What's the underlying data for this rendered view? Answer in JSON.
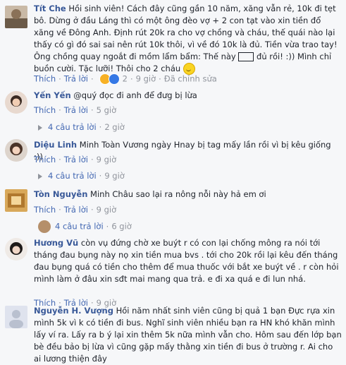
{
  "comments": [
    {
      "author": "Tít Che",
      "text_a": "Hồi sinh viên! Cách đây cũng gần 10 năm, xăng vẫn rẻ, 10k đi tẹt bô. Dừng ở đầu Láng thì có một ông đèo vợ + 2 con tạt vào xin tiền đổ xăng về Đông Anh. Định rút 20k ra cho vợ chồng và cháu, thế quái nào lại thấy có gì đó sai sai nên rút 10k thôi, vì về đó 10k là đủ. Tiền vừa trao tay! Ông chồng quay ngoắt đi mồm lẩm bẩm: Thế này",
      "text_b": "đủ rồi! :)) Mình chỉ buồn cười. Tặc lưỡi! Thôi cho 2 cháu",
      "like": "Thích",
      "reply": "Trả lời",
      "reaction_count": "2",
      "time": "9 giờ",
      "edited": "Đã chỉnh sửa"
    },
    {
      "author": "Yến Yến",
      "text": "@quý đọc đi anh để đưg bị lừa",
      "like": "Thích",
      "reply": "Trả lời",
      "time": "5 giờ",
      "replies": "4 câu trả lời",
      "replies_time": "2 giờ"
    },
    {
      "author": "Diệu Linh",
      "text": "Minh Toàn Vương ngày Hnay bị tag mấy lần rồi vì bị kêu giống :))",
      "like": "Thích",
      "reply": "Trả lời",
      "time": "9 giờ",
      "replies": "4 câu trả lời",
      "replies_time": "9 giờ"
    },
    {
      "author": "Tòn Nguyễn",
      "text": "Minh Châu sao lại ra nông nỗi này hả em ơi",
      "like": "Thích",
      "reply": "Trả lời",
      "time": "9 giờ",
      "replies": "4 câu trả lời",
      "replies_time": "6 giờ"
    },
    {
      "author": "Hương Vũ",
      "text": "còn vụ đứng chờ xe buýt r có con lại chống mông ra nói tới tháng đau bụng này nọ xin tiền mua bvs . tới cho 20k rồi lại kêu đến tháng đau bụng quá có tiền cho thêm để mua thuốc với bắt xe buýt về . r còn hỏi mình làm ở đâu xin sđt mai mang qua trả. e đi xa quá e đi lun nhá.",
      "like": "Thích",
      "reply": "Trả lời",
      "time": "9 giờ"
    },
    {
      "author": "Nguyễn H. Vượng",
      "text": "Hồi năm nhất sinh viên cũng bị quả 1 bạn Đực rựa xin mình 5k vì k có tiền đi bus. Nghĩ sinh viên nhiều bạn ra HN khó khăn mình lấy ví ra. Lấy ra b ý lại xin thêm 5k nữa mình vẫn cho. Hôm sau đến lớp bạn bè đều bảo bị lừa vì cũng gặp mấy thằng xin tiền đi bus ở trường r. Ai cho ai lương thiện đây"
    }
  ],
  "colors": {
    "author": "#385898",
    "link": "#4267b2",
    "meta": "#90949c",
    "background": "#f6f7f9"
  }
}
